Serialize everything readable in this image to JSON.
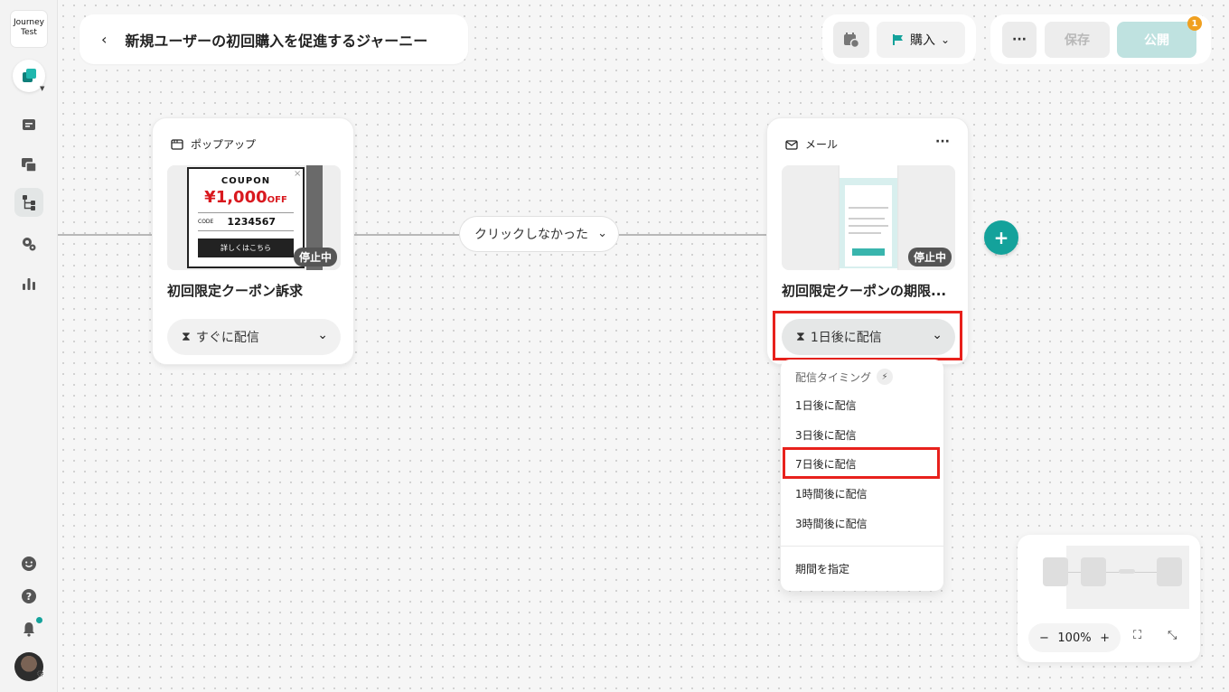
{
  "app": {
    "logo_text": "Journey Test"
  },
  "header": {
    "title": "新規ユーザーの初回購入を促進するジャーニー",
    "goal_label": "購入",
    "more_label": "···",
    "save_label": "保存",
    "publish_label": "公開",
    "publish_badge": "1"
  },
  "flow": {
    "popup_node": {
      "type_label": "ポップアップ",
      "name": "初回限定クーポン訴求",
      "status": "停止中",
      "timing": "すぐに配信",
      "thumb": {
        "coupon_title": "COUPON",
        "amount": "¥1,000",
        "off": "OFF",
        "code_label": "CODE",
        "code": "1234567",
        "cta": "詳しくはこちら"
      }
    },
    "condition": {
      "label": "クリックしなかった"
    },
    "mail_node": {
      "type_label": "メール",
      "name": "初回限定クーポンの期限...",
      "status": "停止中",
      "timing": "1日後に配信"
    }
  },
  "timing_menu": {
    "header": "配信タイミング",
    "options": [
      "1日後に配信",
      "3日後に配信",
      "7日後に配信",
      "1時間後に配信",
      "3時間後に配信"
    ],
    "custom": "期間を指定"
  },
  "minimap": {
    "zoom": "100%"
  },
  "colors": {
    "accent": "#14a29b",
    "highlight": "#e8211c",
    "badge": "#f0a020"
  }
}
